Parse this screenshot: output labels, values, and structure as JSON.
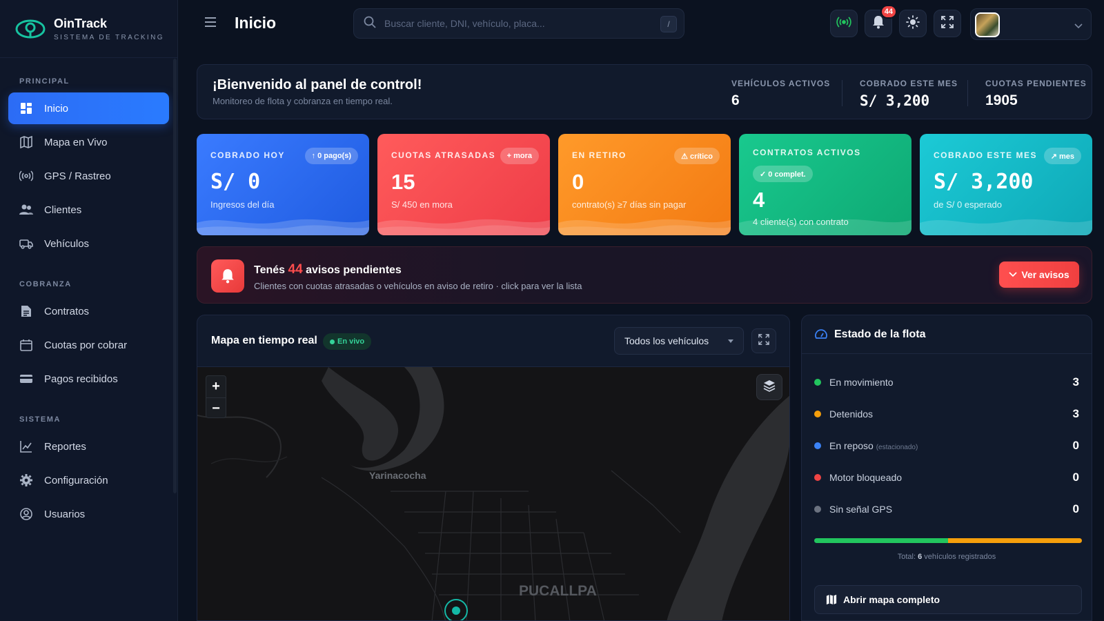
{
  "brand": {
    "name": "OinTrack",
    "subtitle": "SISTEMA DE TRACKING"
  },
  "sidebar": {
    "sections": [
      {
        "title": "PRINCIPAL",
        "items": [
          {
            "label": "Inicio",
            "icon": "dashboard-icon",
            "active": true
          },
          {
            "label": "Mapa en Vivo",
            "icon": "map-icon"
          },
          {
            "label": "GPS / Rastreo",
            "icon": "signal-icon"
          },
          {
            "label": "Clientes",
            "icon": "users-icon"
          },
          {
            "label": "Vehículos",
            "icon": "car-icon"
          }
        ]
      },
      {
        "title": "COBRANZA",
        "items": [
          {
            "label": "Contratos",
            "icon": "document-icon"
          },
          {
            "label": "Cuotas por cobrar",
            "icon": "calendar-icon"
          },
          {
            "label": "Pagos recibidos",
            "icon": "credit-card-icon"
          }
        ]
      },
      {
        "title": "SISTEMA",
        "items": [
          {
            "label": "Reportes",
            "icon": "chart-line-icon"
          },
          {
            "label": "Configuración",
            "icon": "gear-icon"
          },
          {
            "label": "Usuarios",
            "icon": "user-circle-icon"
          }
        ]
      }
    ]
  },
  "topbar": {
    "title": "Inicio",
    "search_placeholder": "Buscar cliente, DNI, vehículo, placa...",
    "search_shortcut": "/",
    "notification_count": "44"
  },
  "welcome": {
    "title": "¡Bienvenido al panel de control!",
    "subtitle": "Monitoreo de flota y cobranza en tiempo real.",
    "stats": [
      {
        "label": "VEHÍCULOS ACTIVOS",
        "value": "6"
      },
      {
        "label": "COBRADO ESTE MES",
        "value": "S/ 3,200"
      },
      {
        "label": "CUOTAS PENDIENTES",
        "value": "1905"
      }
    ]
  },
  "kpis": [
    {
      "label": "COBRADO HOY",
      "pill": "↑ 0 pago(s)",
      "value": "S/ 0",
      "sub": "Ingresos del día",
      "color": "#2f6ff2"
    },
    {
      "label": "CUOTAS ATRASADAS",
      "pill": "+ mora",
      "value": "15",
      "sub": "S/ 450 en mora",
      "color": "#f0454e"
    },
    {
      "label": "EN RETIRO",
      "pill": "⚠ crítico",
      "value": "0",
      "sub": "contrato(s) ≥7 días sin pagar",
      "color": "#f5891c"
    },
    {
      "label": "CONTRATOS ACTIVOS",
      "pill": "✓ 0 complet.",
      "value": "4",
      "sub": "4 cliente(s) con contrato",
      "color": "#13b981"
    },
    {
      "label": "COBRADO ESTE MES",
      "pill": "↗ mes",
      "value": "S/ 3,200",
      "sub": "de S/ 0 esperado",
      "color": "#14b6c5"
    }
  ],
  "alert": {
    "prefix": "Tenés",
    "count": "44",
    "suffix": "avisos pendientes",
    "subtitle": "Clientes con cuotas atrasadas o vehículos en aviso de retiro · click para ver la lista",
    "button": "Ver avisos"
  },
  "map": {
    "title": "Mapa en tiempo real",
    "live_label": "En vivo",
    "vehicle_filter": "Todos los vehículos",
    "zoom_in": "+",
    "zoom_out": "−",
    "places": [
      "Yarinacocha",
      "PUCALLPA"
    ]
  },
  "fleet": {
    "title": "Estado de la flota",
    "rows": [
      {
        "label": "En movimiento",
        "note": "",
        "value": "3",
        "color": "#22c55e"
      },
      {
        "label": "Detenidos",
        "note": "",
        "value": "3",
        "color": "#f59e0b"
      },
      {
        "label": "En reposo",
        "note": "(estacionado)",
        "value": "0",
        "color": "#3b82f6"
      },
      {
        "label": "Motor bloqueado",
        "note": "",
        "value": "0",
        "color": "#ef4444"
      },
      {
        "label": "Sin señal GPS",
        "note": "",
        "value": "0",
        "color": "#6b7280"
      }
    ],
    "bar_fractions": [
      0.5,
      0.5,
      0,
      0,
      0
    ],
    "total_prefix": "Total:",
    "total_count": "6",
    "total_suffix": "vehículos registrados",
    "open_map_button": "Abrir mapa completo"
  }
}
